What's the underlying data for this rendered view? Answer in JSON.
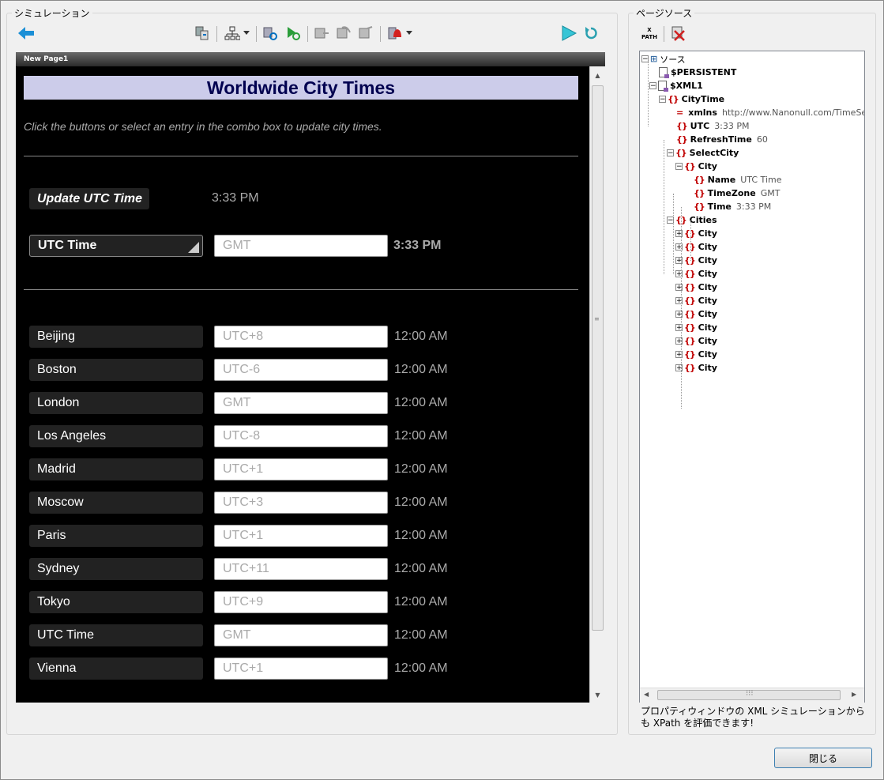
{
  "simulation": {
    "title": "シミュレーション",
    "page_tab": "New Page1",
    "heading": "Worldwide City Times",
    "instructions": "Click the buttons or select an entry in the combo box to update city times.",
    "update_button": "Update UTC Time",
    "update_time": "3:33 PM",
    "combo_value": "UTC Time",
    "combo_zone": "GMT",
    "combo_time": "3:33 PM",
    "cities": [
      {
        "name": "Beijing",
        "zone": "UTC+8",
        "time": "12:00 AM"
      },
      {
        "name": "Boston",
        "zone": "UTC-6",
        "time": "12:00 AM"
      },
      {
        "name": "London",
        "zone": "GMT",
        "time": "12:00 AM"
      },
      {
        "name": "Los Angeles",
        "zone": "UTC-8",
        "time": "12:00 AM"
      },
      {
        "name": "Madrid",
        "zone": "UTC+1",
        "time": "12:00 AM"
      },
      {
        "name": "Moscow",
        "zone": "UTC+3",
        "time": "12:00 AM"
      },
      {
        "name": "Paris",
        "zone": "UTC+1",
        "time": "12:00 AM"
      },
      {
        "name": "Sydney",
        "zone": "UTC+11",
        "time": "12:00 AM"
      },
      {
        "name": "Tokyo",
        "zone": "UTC+9",
        "time": "12:00 AM"
      },
      {
        "name": "UTC Time",
        "zone": "GMT",
        "time": "12:00 AM"
      },
      {
        "name": "Vienna",
        "zone": "UTC+1",
        "time": "12:00 AM"
      }
    ]
  },
  "page_source": {
    "title": "ページソース",
    "xpath_label": "X\nPATH",
    "tree": {
      "root": "ソース",
      "persistent": "$PERSISTENT",
      "xml1": "$XML1",
      "citytime": "CityTime",
      "xmlns_name": "xmlns",
      "xmlns_value": "http://www.Nanonull.com/TimeServi",
      "utc_name": "UTC",
      "utc_value": "3:33 PM",
      "refresh_name": "RefreshTime",
      "refresh_value": "60",
      "selectcity": "SelectCity",
      "city": "City",
      "name_name": "Name",
      "name_value": "UTC Time",
      "timezone_name": "TimeZone",
      "timezone_value": "GMT",
      "time_name": "Time",
      "time_value": "3:33 PM",
      "cities": "Cities",
      "city_items": [
        "City",
        "City",
        "City",
        "City",
        "City",
        "City",
        "City",
        "City",
        "City",
        "City",
        "City"
      ]
    },
    "hint": "プロパティウィンドウの XML シミュレーションからも XPath を評価できます!"
  },
  "close_button": "閉じる",
  "colors": {
    "title_bar_bg": "#ccccea",
    "title_text": "#000050",
    "canvas_bg": "#000000",
    "element_icon": "#c00000"
  }
}
